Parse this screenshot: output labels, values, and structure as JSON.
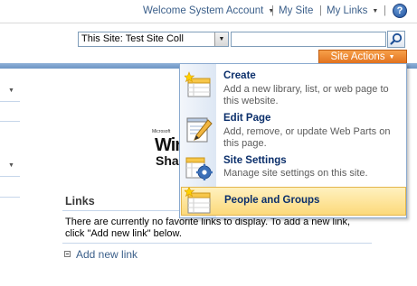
{
  "topbar": {
    "welcome": "Welcome System Account",
    "my_site": "My Site",
    "my_links": "My Links",
    "separator": "|",
    "help_glyph": "?"
  },
  "search": {
    "scope_value": "This Site: Test Site Coll",
    "query_value": ""
  },
  "site_actions": {
    "label": "Site Actions"
  },
  "logo": {
    "small": "Microsoft",
    "line1": "Win",
    "line2": "Sha"
  },
  "links_part": {
    "title": "Links",
    "empty_line1": "There are currently no favorite links to display. To add a new link,",
    "empty_line2": "click \"Add new link\" below.",
    "add_link": "Add new link"
  },
  "menu": {
    "items": [
      {
        "label": "Create",
        "desc1": "Add a new library, list, or web page to",
        "desc2": "this website.",
        "icon": "create-icon"
      },
      {
        "label": "Edit Page",
        "desc1": "Add, remove, or update Web Parts on",
        "desc2": "this page.",
        "icon": "edit-page-icon"
      },
      {
        "label": "Site Settings",
        "desc1": "Manage site settings on this site.",
        "desc2": "",
        "icon": "site-settings-icon"
      },
      {
        "label": "People and Groups",
        "desc1": "",
        "desc2": "",
        "icon": "people-groups-icon"
      }
    ],
    "selected_index": 3
  },
  "colors": {
    "link": "#3b5f8a",
    "site_actions_bg": "#e0701c",
    "menu_label": "#0b2f6b",
    "menu_highlight": "#fcd97a",
    "band": "#6d95c4"
  }
}
